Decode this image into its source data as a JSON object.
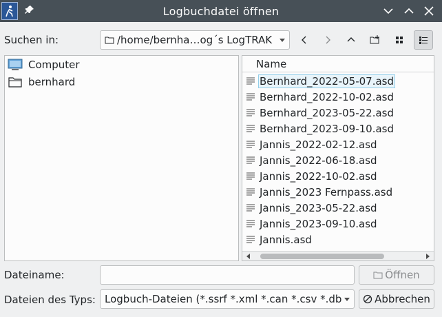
{
  "window": {
    "title": "Logbuchdatei öffnen"
  },
  "look_in": {
    "label": "Suchen in:",
    "path": "/home/bernha…og´s LogTRAK"
  },
  "places": [
    {
      "label": "Computer",
      "icon": "computer-icon"
    },
    {
      "label": "bernhard",
      "icon": "folder-icon"
    }
  ],
  "files": {
    "column_header": "Name",
    "items": [
      "Bernhard_2022-05-07.asd",
      "Bernhard_2022-10-02.asd",
      "Bernhard_2023-05-22.asd",
      "Bernhard_2023-09-10.asd",
      "Jannis_2022-02-12.asd",
      "Jannis_2022-06-18.asd",
      "Jannis_2022-10-02.asd",
      "Jannis_2023 Fernpass.asd",
      "Jannis_2023-05-22.asd",
      "Jannis_2023-09-10.asd",
      "Jannis.asd"
    ]
  },
  "filename": {
    "label": "Dateiname:",
    "value": ""
  },
  "filetype": {
    "label": "Dateien des Typs:",
    "value": "Logbuch-Dateien (*.ssrf *.xml *.can *.csv *.db"
  },
  "buttons": {
    "open": "Öffnen",
    "cancel": "Abbrechen"
  },
  "colors": {
    "titlebar": "#475057",
    "focus": "#93cee9"
  }
}
